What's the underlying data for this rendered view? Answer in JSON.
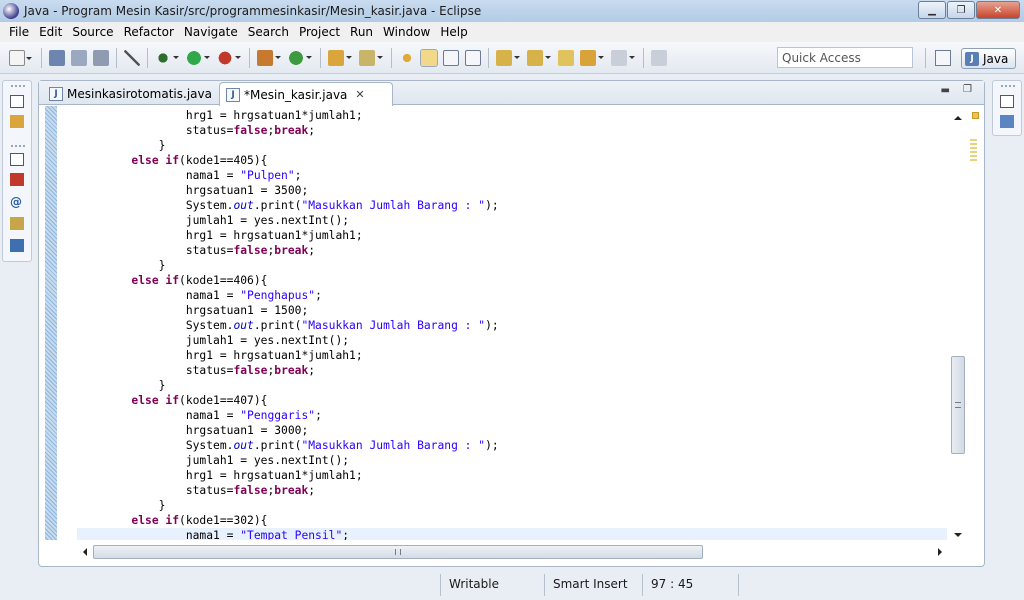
{
  "window": {
    "title": "Java - Program Mesin Kasir/src/programmesinkasir/Mesin_kasir.java - Eclipse",
    "minimize": "▁",
    "maximize": "❐",
    "close": "✕"
  },
  "menu": [
    "File",
    "Edit",
    "Source",
    "Refactor",
    "Navigate",
    "Search",
    "Project",
    "Run",
    "Window",
    "Help"
  ],
  "toolbar": {
    "quick_access_placeholder": "Quick Access",
    "perspective_label": "Java"
  },
  "tabs": [
    {
      "label": "Mesinkasirotomatis.java",
      "icon": "java-file-icon",
      "active": false
    },
    {
      "label": "*Mesin_kasir.java",
      "icon": "java-file-icon",
      "active": true,
      "close": "✕"
    }
  ],
  "code_lines": [
    [
      [
        "",
        "                hrg1 = hrgsatuan1*jumlah1;"
      ]
    ],
    [
      [
        "",
        "                status="
      ],
      [
        "kw",
        "false"
      ],
      [
        "",
        ";"
      ],
      [
        "kw",
        "break"
      ],
      [
        "",
        ";"
      ]
    ],
    [
      [
        "",
        "            }"
      ]
    ],
    [
      [
        "kw",
        "        else if"
      ],
      [
        "",
        "(kode1==405){"
      ]
    ],
    [
      [
        "",
        "                nama1 = "
      ],
      [
        "str",
        "\"Pulpen\""
      ],
      [
        "",
        ";"
      ]
    ],
    [
      [
        "",
        "                hrgsatuan1 = 3500;"
      ]
    ],
    [
      [
        "",
        "                System."
      ],
      [
        "ital",
        "out"
      ],
      [
        "",
        ".print("
      ],
      [
        "str",
        "\"Masukkan Jumlah Barang : \""
      ],
      [
        "",
        ");"
      ]
    ],
    [
      [
        "",
        "                jumlah1 = yes.nextInt();"
      ]
    ],
    [
      [
        "",
        "                hrg1 = hrgsatuan1*jumlah1;"
      ]
    ],
    [
      [
        "",
        "                status="
      ],
      [
        "kw",
        "false"
      ],
      [
        "",
        ";"
      ],
      [
        "kw",
        "break"
      ],
      [
        "",
        ";"
      ]
    ],
    [
      [
        "",
        "            }"
      ]
    ],
    [
      [
        "kw",
        "        else if"
      ],
      [
        "",
        "(kode1==406){"
      ]
    ],
    [
      [
        "",
        "                nama1 = "
      ],
      [
        "str",
        "\"Penghapus\""
      ],
      [
        "",
        ";"
      ]
    ],
    [
      [
        "",
        "                hrgsatuan1 = 1500;"
      ]
    ],
    [
      [
        "",
        "                System."
      ],
      [
        "ital",
        "out"
      ],
      [
        "",
        ".print("
      ],
      [
        "str",
        "\"Masukkan Jumlah Barang : \""
      ],
      [
        "",
        ");"
      ]
    ],
    [
      [
        "",
        "                jumlah1 = yes.nextInt();"
      ]
    ],
    [
      [
        "",
        "                hrg1 = hrgsatuan1*jumlah1;"
      ]
    ],
    [
      [
        "",
        "                status="
      ],
      [
        "kw",
        "false"
      ],
      [
        "",
        ";"
      ],
      [
        "kw",
        "break"
      ],
      [
        "",
        ";"
      ]
    ],
    [
      [
        "",
        "            }"
      ]
    ],
    [
      [
        "kw",
        "        else if"
      ],
      [
        "",
        "(kode1==407){"
      ]
    ],
    [
      [
        "",
        "                nama1 = "
      ],
      [
        "str",
        "\"Penggaris\""
      ],
      [
        "",
        ";"
      ]
    ],
    [
      [
        "",
        "                hrgsatuan1 = 3000;"
      ]
    ],
    [
      [
        "",
        "                System."
      ],
      [
        "ital",
        "out"
      ],
      [
        "",
        ".print("
      ],
      [
        "str",
        "\"Masukkan Jumlah Barang : \""
      ],
      [
        "",
        ");"
      ]
    ],
    [
      [
        "",
        "                jumlah1 = yes.nextInt();"
      ]
    ],
    [
      [
        "",
        "                hrg1 = hrgsatuan1*jumlah1;"
      ]
    ],
    [
      [
        "",
        "                status="
      ],
      [
        "kw",
        "false"
      ],
      [
        "",
        ";"
      ],
      [
        "kw",
        "break"
      ],
      [
        "",
        ";"
      ]
    ],
    [
      [
        "",
        "            }"
      ]
    ],
    [
      [
        "kw",
        "        else if"
      ],
      [
        "",
        "(kode1==302){"
      ]
    ],
    [
      [
        "",
        "                nama1 = "
      ],
      [
        "str",
        "\"Tempat Pensil\""
      ],
      [
        "",
        ";"
      ]
    ]
  ],
  "current_line_index": 28,
  "status": {
    "write_mode": "Writable",
    "insert_mode": "Smart Insert",
    "cursor_position": "97 : 45"
  },
  "colors": {
    "keyword": "#7f0055",
    "string": "#2a00ff",
    "field": "#0000c0",
    "current_line": "#e8f2fe"
  }
}
